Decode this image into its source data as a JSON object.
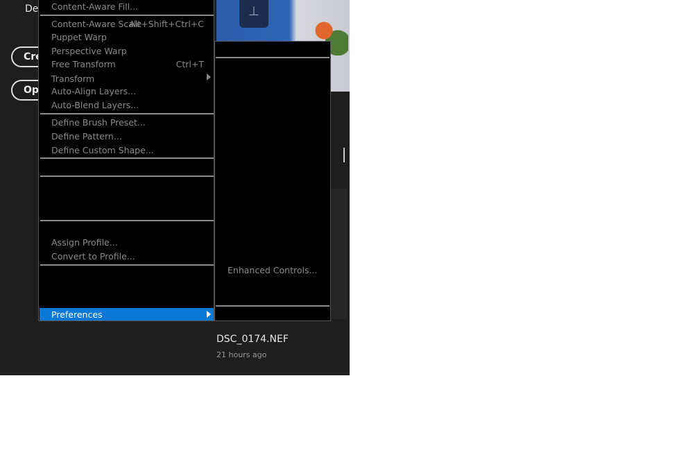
{
  "background": {
    "partial_label": "Del",
    "create_button": "Cre",
    "open_button": "Op"
  },
  "recent_file": {
    "name": "DSC_0174.NEF",
    "time": "21 hours ago"
  },
  "edit_menu": {
    "items": [
      {
        "label": "Content-Aware Fill..."
      },
      {
        "label": "Content-Aware Scale",
        "shortcut": "Alt+Shift+Ctrl+C"
      },
      {
        "label": "Puppet Warp"
      },
      {
        "label": "Perspective Warp"
      },
      {
        "label": "Free Transform",
        "shortcut": "Ctrl+T"
      },
      {
        "label": "Transform"
      },
      {
        "label": "Auto-Align Layers..."
      },
      {
        "label": "Auto-Blend Layers..."
      },
      {
        "label": "Define Brush Preset..."
      },
      {
        "label": "Define Pattern..."
      },
      {
        "label": "Define Custom Shape..."
      },
      {
        "label": "Assign Profile..."
      },
      {
        "label": "Convert to Profile..."
      }
    ],
    "highlighted": "Preferences",
    "highlight_color": "#0a78d7"
  },
  "preferences_submenu": {
    "items": [
      {
        "label": "Enhanced Controls..."
      }
    ]
  }
}
